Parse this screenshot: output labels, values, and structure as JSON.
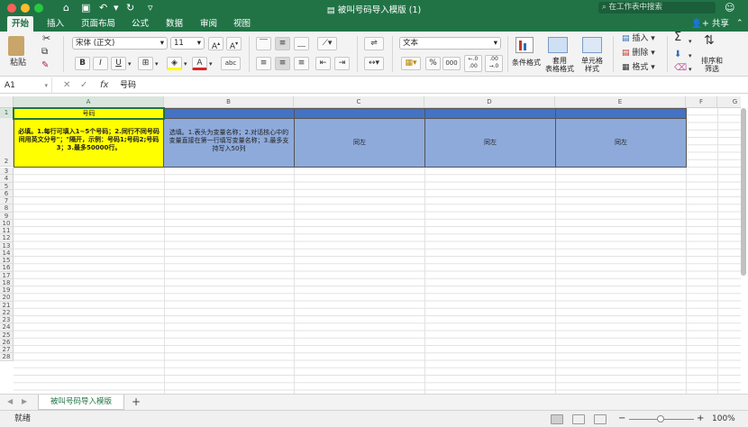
{
  "window": {
    "title": "被叫号码导入模版 (1)",
    "search_placeholder": "在工作表中搜索"
  },
  "tabs": [
    "开始",
    "插入",
    "页面布局",
    "公式",
    "数据",
    "审阅",
    "视图"
  ],
  "share_label": "共享",
  "ribbon": {
    "paste_label": "粘贴",
    "font_name": "宋体 (正文)",
    "font_size": "11",
    "number_format": "文本",
    "bold": "B",
    "italic": "I",
    "underline": "U",
    "percent": "%",
    "thousands": "000",
    "dec_inc": "←.0\n.00",
    "cond_format_label": "条件格式",
    "table_format_label": "套用\n表格格式",
    "cell_style_label": "单元格\n样式",
    "insert_label": "插入",
    "delete_label": "删除",
    "format_label": "格式",
    "sort_filter_label": "排序和\n筛选"
  },
  "formula_bar": {
    "name_box": "A1",
    "content": "号码"
  },
  "columns": [
    "A",
    "B",
    "C",
    "D",
    "E",
    "F",
    "G"
  ],
  "rows": [
    "1",
    "2",
    "3",
    "4",
    "5",
    "6",
    "7",
    "8",
    "9",
    "10",
    "11",
    "12",
    "13",
    "14",
    "15",
    "16",
    "17",
    "18",
    "19",
    "20",
    "21",
    "22",
    "23",
    "24",
    "25",
    "26",
    "27",
    "28"
  ],
  "cells": {
    "A1": "号码",
    "A2": "必填。1.每行可填入1~5个号码；2.同行不同号码间用英文分号\"；\"隔开，示例：号码1;号码2;号码3；3.最多50000行。",
    "B2": "选填。1.表头为变量名称；2.对话核心中的变量直接在第一行填写变量名称；3.最多支持写入50列",
    "C2": "同左",
    "D2": "同左",
    "E2": "同左"
  },
  "sheet_tab": "被叫号码导入模版",
  "status": {
    "mode": "就绪",
    "zoom": "100%"
  },
  "colors": {
    "accent": "#217346",
    "yellow_cell": "#ffff00",
    "blue_header": "#4472c4",
    "blue_cell": "#8eaadb"
  }
}
